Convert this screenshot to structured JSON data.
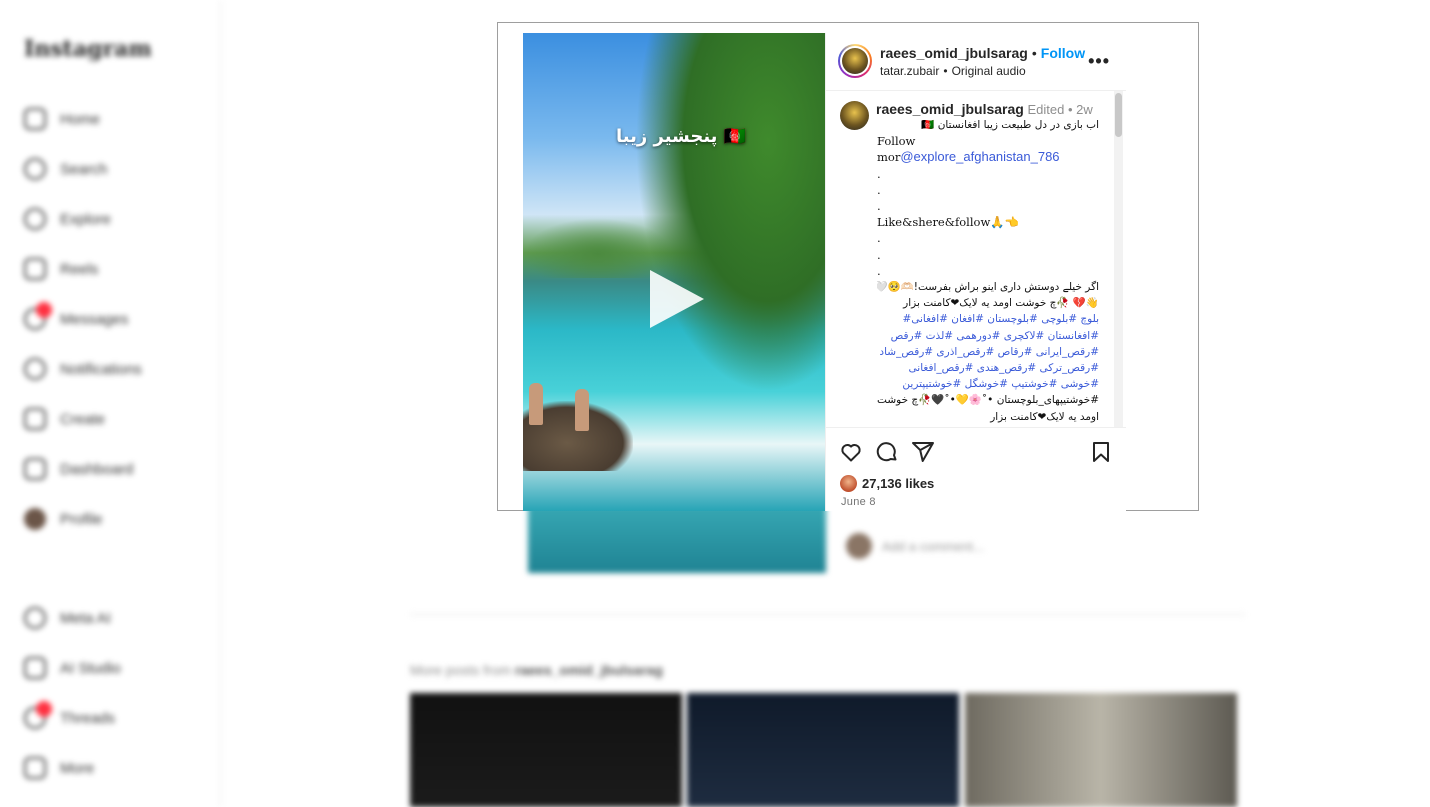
{
  "sidebar": {
    "logo": "Instagram",
    "items": [
      {
        "label": "Home",
        "icon": "home-icon"
      },
      {
        "label": "Search",
        "icon": "search-icon"
      },
      {
        "label": "Explore",
        "icon": "explore-icon"
      },
      {
        "label": "Reels",
        "icon": "reels-icon"
      },
      {
        "label": "Messages",
        "icon": "messages-icon"
      },
      {
        "label": "Notifications",
        "icon": "heart-icon"
      },
      {
        "label": "Create",
        "icon": "create-icon"
      },
      {
        "label": "Dashboard",
        "icon": "dashboard-icon"
      },
      {
        "label": "Profile",
        "icon": "profile-avatar"
      }
    ],
    "bottom_items": [
      {
        "label": "Meta AI",
        "icon": "meta-ai-icon"
      },
      {
        "label": "AI Studio",
        "icon": "ai-studio-icon"
      },
      {
        "label": "Threads",
        "icon": "threads-icon"
      },
      {
        "label": "More",
        "icon": "menu-icon"
      }
    ]
  },
  "background": {
    "comment_placeholder": "Add a comment...",
    "more_posts_prefix": "More posts from",
    "more_posts_user": "raees_omid_jbulsarag"
  },
  "post": {
    "video_overlay_text": "پنجشیر زیبا 🇦🇫",
    "header": {
      "username": "raees_omid_jbulsarag",
      "follow_label": "Follow",
      "audio_user": "tatar.zubair",
      "audio_label": "Original audio"
    },
    "caption": {
      "username": "raees_omid_jbulsarag",
      "edited": "Edited",
      "time": "2w",
      "lines": [
        {
          "text": "اب بازی در دل طبیعت زیبا افغانستان 🇦🇫",
          "type": "rtl"
        },
        {
          "text": "Follow",
          "type": "mono"
        },
        {
          "prefix": "mor",
          "mention": "@explore_afghanistan_786",
          "type": "mention"
        },
        {
          "text": ".",
          "type": "mono"
        },
        {
          "text": ".",
          "type": "mono"
        },
        {
          "text": ".",
          "type": "mono"
        },
        {
          "text": "Like&shere&follow🙏👈",
          "type": "mono"
        },
        {
          "text": ".",
          "type": "mono"
        },
        {
          "text": ".",
          "type": "mono"
        },
        {
          "text": ".",
          "type": "mono"
        },
        {
          "text": "اگر خیلے دوستش داری اینو براش بفرست!🫶🏻🥺🤍",
          "type": "rtl"
        },
        {
          "text": "👋💔 🥀چ خوشت اومد یه لایک❤کامنت بزار",
          "type": "rtl"
        },
        {
          "text": "بلوچ #بلوچی #بلوچستان #افغان #افغانی#",
          "type": "rtl-link"
        },
        {
          "text": "#افغانستان #لاکچری #دورهمی #لذت #رقص",
          "type": "rtl-link"
        },
        {
          "text": "#رقص_ایرانی #رقاص #رقص_اذری #رقص_شاد",
          "type": "rtl-link"
        },
        {
          "text": "#رقص_ترکی #رقص_هندی #رقص_افغانی",
          "type": "rtl-link"
        },
        {
          "text": "#خوشی #خوشتیپ #خوشگل #خوشتیپترین",
          "type": "rtl-link"
        },
        {
          "text": "#خوشتیپهای_بلوچستان •˚🌸💛•˚🖤🥀چ خوشت",
          "type": "rtl-mixed"
        },
        {
          "text": "اومد یه لایک❤کامنت بزار",
          "type": "rtl"
        }
      ]
    },
    "likes": "27,136 likes",
    "date": "June 8"
  }
}
